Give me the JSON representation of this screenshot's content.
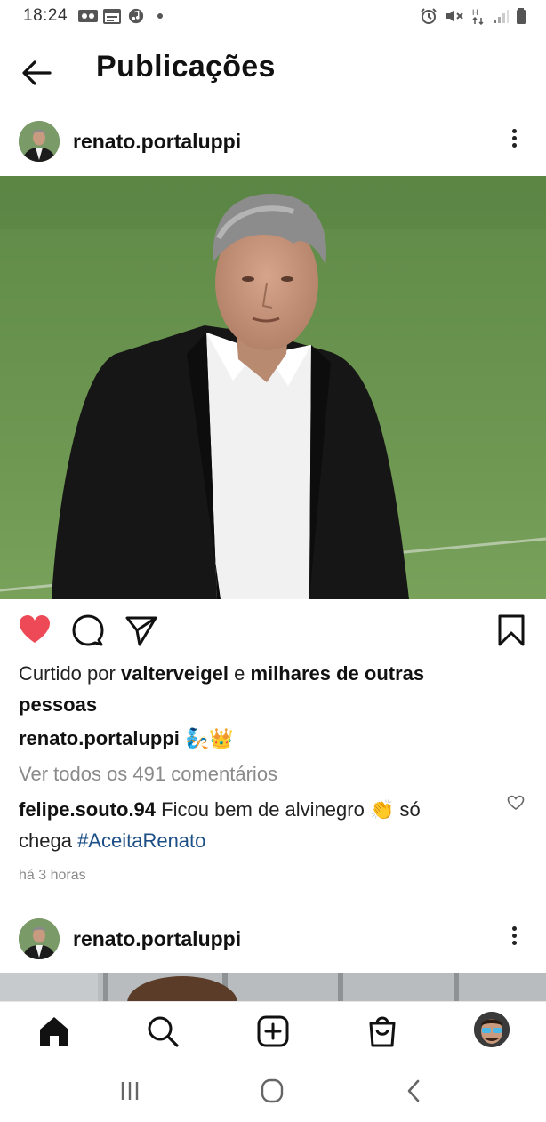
{
  "status_bar": {
    "time": "18:24",
    "icons": [
      "voicemail-icon",
      "calendar-icon",
      "music-icon",
      "dot-icon",
      "alarm-icon",
      "mute-icon",
      "data-icon",
      "signal-icon",
      "battery-icon"
    ]
  },
  "header": {
    "title": "Publicações",
    "back_icon": "back-arrow-icon"
  },
  "post": {
    "username": "renato.portaluppi",
    "liked_by_prefix": "Curtido por ",
    "liked_by_user": "valterveigel",
    "liked_by_mid": " e ",
    "liked_by_rest_1": "milhares de outras",
    "liked_by_rest_2": "pessoas",
    "caption_user": "renato.portaluppi",
    "caption_emojis": "🧞👑",
    "view_comments": "Ver todos os 491 comentários",
    "comment_user": "felipe.souto.94",
    "comment_text_1": " Ficou bem de alvinegro ",
    "comment_emoji": "👏",
    "comment_text_2": " só",
    "comment_text_3": "chega ",
    "comment_hashtag": "#AceitaRenato",
    "timestamp": "há 3 horas",
    "liked": true,
    "colors": {
      "like_red": "#ed4956",
      "hashtag_blue": "#1d4f87"
    }
  },
  "post2": {
    "username": "renato.portaluppi"
  },
  "bottom_nav": {
    "items": [
      "home-icon",
      "search-icon",
      "new-post-icon",
      "shop-icon",
      "profile-avatar"
    ]
  },
  "system_nav": {
    "items": [
      "recents-icon",
      "home-circle-icon",
      "back-chevron-icon"
    ]
  }
}
